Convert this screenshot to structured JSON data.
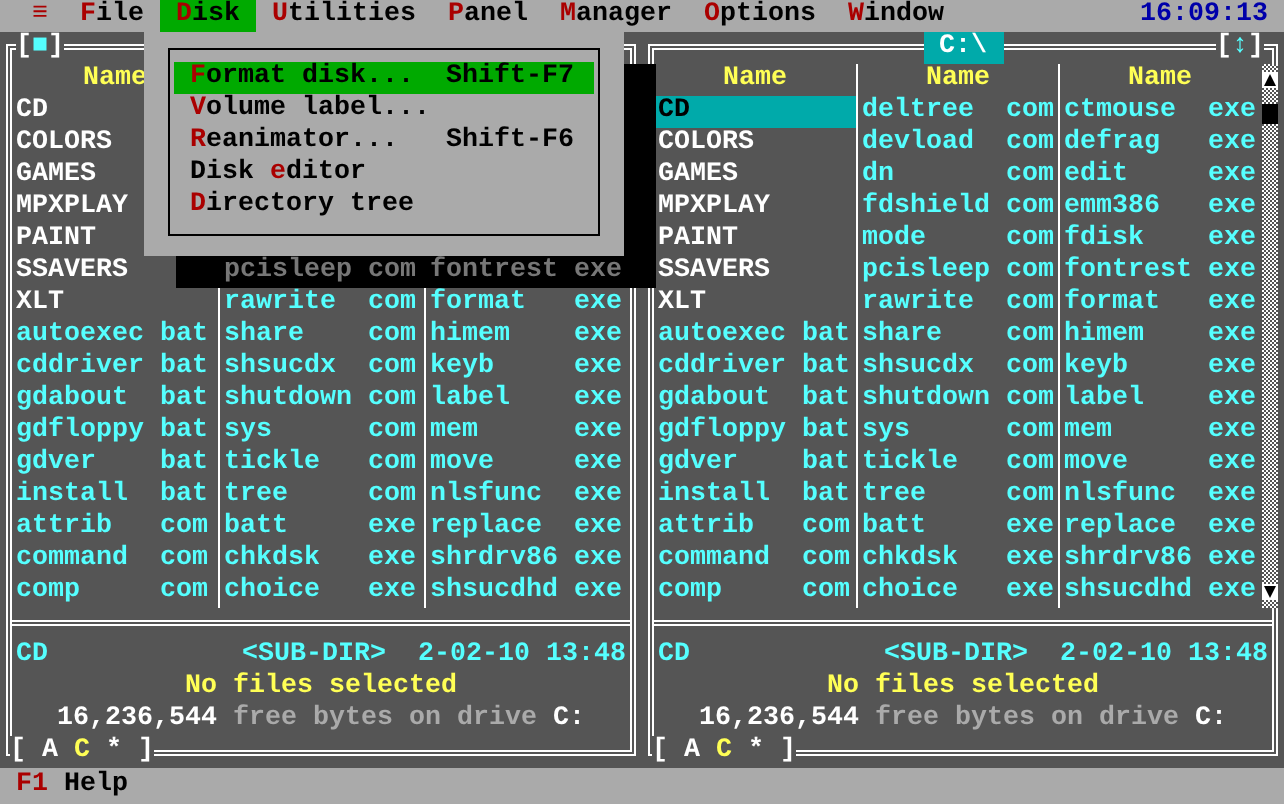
{
  "menu_bar": {
    "items": [
      {
        "key": "≡",
        "selected": false
      },
      {
        "key": "F",
        "post": "ile",
        "selected": false
      },
      {
        "key": "D",
        "post": "isk",
        "selected": true
      },
      {
        "key": "U",
        "post": "tilities",
        "selected": false
      },
      {
        "key": "P",
        "post": "anel",
        "selected": false
      },
      {
        "key": "M",
        "post": "anager",
        "selected": false
      },
      {
        "key": "O",
        "post": "ptions",
        "selected": false
      },
      {
        "key": "W",
        "post": "indow",
        "selected": false
      }
    ],
    "clock": "16:09:13"
  },
  "disk_menu": {
    "items": [
      {
        "key": "F",
        "post": "ormat disk...",
        "shortcut": "Shift-F7",
        "selected": true
      },
      {
        "key": "V",
        "post": "olume label...",
        "selected": false
      },
      {
        "key": "R",
        "post": "eanimator...",
        "shortcut": "Shift-F6",
        "selected": false
      },
      {
        "pre": "Disk ",
        "key": "e",
        "post": "ditor",
        "selected": false
      },
      {
        "key": "D",
        "post": "irectory tree",
        "selected": false
      }
    ]
  },
  "panels": [
    {
      "title_button": [
        "[",
        "■",
        "]"
      ],
      "columns": [
        {
          "header": "Name",
          "rows": [
            {
              "name": "CD",
              "kind": "dir",
              "selected": false
            },
            {
              "name": "COLORS",
              "kind": "dir",
              "selected": false
            },
            {
              "name": "GAMES",
              "kind": "dir",
              "selected": false
            },
            {
              "name": "MPXPLAY",
              "kind": "dir",
              "selected": false
            },
            {
              "name": "PAINT",
              "kind": "dir",
              "selected": false
            },
            {
              "name": "SSAVERS",
              "kind": "dir",
              "selected": false
            },
            {
              "name": "XLT",
              "kind": "dir",
              "selected": false
            },
            {
              "name": "autoexec",
              "ext": "bat",
              "kind": "file",
              "selected": false
            },
            {
              "name": "cddriver",
              "ext": "bat",
              "kind": "file",
              "selected": false
            },
            {
              "name": "gdabout",
              "ext": "bat",
              "kind": "file",
              "selected": false
            },
            {
              "name": "gdfloppy",
              "ext": "bat",
              "kind": "file",
              "selected": false
            },
            {
              "name": "gdver",
              "ext": "bat",
              "kind": "file",
              "selected": false
            },
            {
              "name": "install",
              "ext": "bat",
              "kind": "file",
              "selected": false
            },
            {
              "name": "attrib",
              "ext": "com",
              "kind": "file",
              "selected": false
            },
            {
              "name": "command",
              "ext": "com",
              "kind": "file",
              "selected": false
            },
            {
              "name": "comp",
              "ext": "com",
              "kind": "file",
              "selected": false
            }
          ]
        },
        {
          "rows": [
            {
              "name": "pcisleep",
              "ext": "com",
              "kind": "file",
              "selected": false,
              "shadowed": true
            },
            {
              "name": "rawrite",
              "ext": "com",
              "kind": "file",
              "selected": false,
              "shadowed": false
            },
            {
              "name": "share",
              "ext": "com",
              "kind": "file",
              "selected": false,
              "shadowed": false
            },
            {
              "name": "shsucdx",
              "ext": "com",
              "kind": "file",
              "selected": false,
              "shadowed": false
            },
            {
              "name": "shutdown",
              "ext": "com",
              "kind": "file",
              "selected": false,
              "shadowed": false
            },
            {
              "name": "sys",
              "ext": "com",
              "kind": "file",
              "selected": false,
              "shadowed": false
            },
            {
              "name": "tickle",
              "ext": "com",
              "kind": "file",
              "selected": false,
              "shadowed": false
            },
            {
              "name": "tree",
              "ext": "com",
              "kind": "file",
              "selected": false,
              "shadowed": false
            },
            {
              "name": "batt",
              "ext": "exe",
              "kind": "file",
              "selected": false,
              "shadowed": false
            },
            {
              "name": "chkdsk",
              "ext": "exe",
              "kind": "file",
              "selected": false,
              "shadowed": false
            },
            {
              "name": "choice",
              "ext": "exe",
              "kind": "file",
              "selected": false,
              "shadowed": false
            }
          ]
        },
        {
          "rows": [
            {
              "name": "fontrest",
              "ext": "exe",
              "kind": "file",
              "selected": false,
              "shadowed": true
            },
            {
              "name": "format",
              "ext": "exe",
              "kind": "file",
              "selected": false,
              "shadowed": false
            },
            {
              "name": "himem",
              "ext": "exe",
              "kind": "file",
              "selected": false,
              "shadowed": false
            },
            {
              "name": "keyb",
              "ext": "exe",
              "kind": "file",
              "selected": false,
              "shadowed": false
            },
            {
              "name": "label",
              "ext": "exe",
              "kind": "file",
              "selected": false,
              "shadowed": false
            },
            {
              "name": "mem",
              "ext": "exe",
              "kind": "file",
              "selected": false,
              "shadowed": false
            },
            {
              "name": "move",
              "ext": "exe",
              "kind": "file",
              "selected": false,
              "shadowed": false
            },
            {
              "name": "nlsfunc",
              "ext": "exe",
              "kind": "file",
              "selected": false,
              "shadowed": false
            },
            {
              "name": "replace",
              "ext": "exe",
              "kind": "file",
              "selected": false,
              "shadowed": false
            },
            {
              "name": "shrdrv86",
              "ext": "exe",
              "kind": "file",
              "selected": false,
              "shadowed": false
            },
            {
              "name": "shsucdhd",
              "ext": "exe",
              "kind": "file",
              "selected": false,
              "shadowed": false
            }
          ]
        }
      ],
      "info": {
        "name": "CD",
        "type": "<SUB-DIR>",
        "date": "2-02-10",
        "time": "13:48"
      },
      "selection": "No files selected",
      "free": {
        "bytes": "16,236,544",
        "label": "free bytes on drive",
        "drive": "C:"
      },
      "drives": {
        "open": "[",
        "items": [
          {
            "label": "A",
            "selected": false
          },
          {
            "label": "C",
            "selected": true
          },
          {
            "label": "*",
            "selected": false
          }
        ],
        "close": "]"
      }
    },
    {
      "path": "C:\\",
      "sort_button": [
        "[",
        "↕",
        "]"
      ],
      "columns": [
        {
          "header": "Name",
          "rows": [
            {
              "name": "CD",
              "kind": "dir",
              "selected": true
            },
            {
              "name": "COLORS",
              "kind": "dir",
              "selected": false
            },
            {
              "name": "GAMES",
              "kind": "dir",
              "selected": false
            },
            {
              "name": "MPXPLAY",
              "kind": "dir",
              "selected": false
            },
            {
              "name": "PAINT",
              "kind": "dir",
              "selected": false
            },
            {
              "name": "SSAVERS",
              "kind": "dir",
              "selected": false
            },
            {
              "name": "XLT",
              "kind": "dir",
              "selected": false
            },
            {
              "name": "autoexec",
              "ext": "bat",
              "kind": "file",
              "selected": false
            },
            {
              "name": "cddriver",
              "ext": "bat",
              "kind": "file",
              "selected": false
            },
            {
              "name": "gdabout",
              "ext": "bat",
              "kind": "file",
              "selected": false
            },
            {
              "name": "gdfloppy",
              "ext": "bat",
              "kind": "file",
              "selected": false
            },
            {
              "name": "gdver",
              "ext": "bat",
              "kind": "file",
              "selected": false
            },
            {
              "name": "install",
              "ext": "bat",
              "kind": "file",
              "selected": false
            },
            {
              "name": "attrib",
              "ext": "com",
              "kind": "file",
              "selected": false
            },
            {
              "name": "command",
              "ext": "com",
              "kind": "file",
              "selected": false
            },
            {
              "name": "comp",
              "ext": "com",
              "kind": "file",
              "selected": false
            }
          ]
        },
        {
          "header": "Name",
          "rows": [
            {
              "name": "deltree",
              "ext": "com",
              "kind": "file",
              "selected": false
            },
            {
              "name": "devload",
              "ext": "com",
              "kind": "file",
              "selected": false
            },
            {
              "name": "dn",
              "ext": "com",
              "kind": "file",
              "selected": false
            },
            {
              "name": "fdshield",
              "ext": "com",
              "kind": "file",
              "selected": false
            },
            {
              "name": "mode",
              "ext": "com",
              "kind": "file",
              "selected": false
            },
            {
              "name": "pcisleep",
              "ext": "com",
              "kind": "file",
              "selected": false
            },
            {
              "name": "rawrite",
              "ext": "com",
              "kind": "file",
              "selected": false
            },
            {
              "name": "share",
              "ext": "com",
              "kind": "file",
              "selected": false
            },
            {
              "name": "shsucdx",
              "ext": "com",
              "kind": "file",
              "selected": false
            },
            {
              "name": "shutdown",
              "ext": "com",
              "kind": "file",
              "selected": false
            },
            {
              "name": "sys",
              "ext": "com",
              "kind": "file",
              "selected": false
            },
            {
              "name": "tickle",
              "ext": "com",
              "kind": "file",
              "selected": false
            },
            {
              "name": "tree",
              "ext": "com",
              "kind": "file",
              "selected": false
            },
            {
              "name": "batt",
              "ext": "exe",
              "kind": "file",
              "selected": false
            },
            {
              "name": "chkdsk",
              "ext": "exe",
              "kind": "file",
              "selected": false
            },
            {
              "name": "choice",
              "ext": "exe",
              "kind": "file",
              "selected": false
            }
          ]
        },
        {
          "header": "Name",
          "rows": [
            {
              "name": "ctmouse",
              "ext": "exe",
              "kind": "file",
              "selected": false
            },
            {
              "name": "defrag",
              "ext": "exe",
              "kind": "file",
              "selected": false
            },
            {
              "name": "edit",
              "ext": "exe",
              "kind": "file",
              "selected": false
            },
            {
              "name": "emm386",
              "ext": "exe",
              "kind": "file",
              "selected": false
            },
            {
              "name": "fdisk",
              "ext": "exe",
              "kind": "file",
              "selected": false
            },
            {
              "name": "fontrest",
              "ext": "exe",
              "kind": "file",
              "selected": false
            },
            {
              "name": "format",
              "ext": "exe",
              "kind": "file",
              "selected": false
            },
            {
              "name": "himem",
              "ext": "exe",
              "kind": "file",
              "selected": false
            },
            {
              "name": "keyb",
              "ext": "exe",
              "kind": "file",
              "selected": false
            },
            {
              "name": "label",
              "ext": "exe",
              "kind": "file",
              "selected": false
            },
            {
              "name": "mem",
              "ext": "exe",
              "kind": "file",
              "selected": false
            },
            {
              "name": "move",
              "ext": "exe",
              "kind": "file",
              "selected": false
            },
            {
              "name": "nlsfunc",
              "ext": "exe",
              "kind": "file",
              "selected": false
            },
            {
              "name": "replace",
              "ext": "exe",
              "kind": "file",
              "selected": false
            },
            {
              "name": "shrdrv86",
              "ext": "exe",
              "kind": "file",
              "selected": false
            },
            {
              "name": "shsucdhd",
              "ext": "exe",
              "kind": "file",
              "selected": false
            }
          ]
        }
      ],
      "info": {
        "name": "CD",
        "type": "<SUB-DIR>",
        "date": "2-02-10",
        "time": "13:48"
      },
      "selection": "No files selected",
      "free": {
        "bytes": "16,236,544",
        "label": "free bytes on drive",
        "drive": "C:"
      },
      "drives": {
        "open": "[",
        "items": [
          {
            "label": "A",
            "selected": false
          },
          {
            "label": "C",
            "selected": true
          },
          {
            "label": "*",
            "selected": false
          }
        ],
        "close": "]"
      }
    }
  ],
  "status_bar": {
    "key": "F1",
    "label": "Help"
  }
}
